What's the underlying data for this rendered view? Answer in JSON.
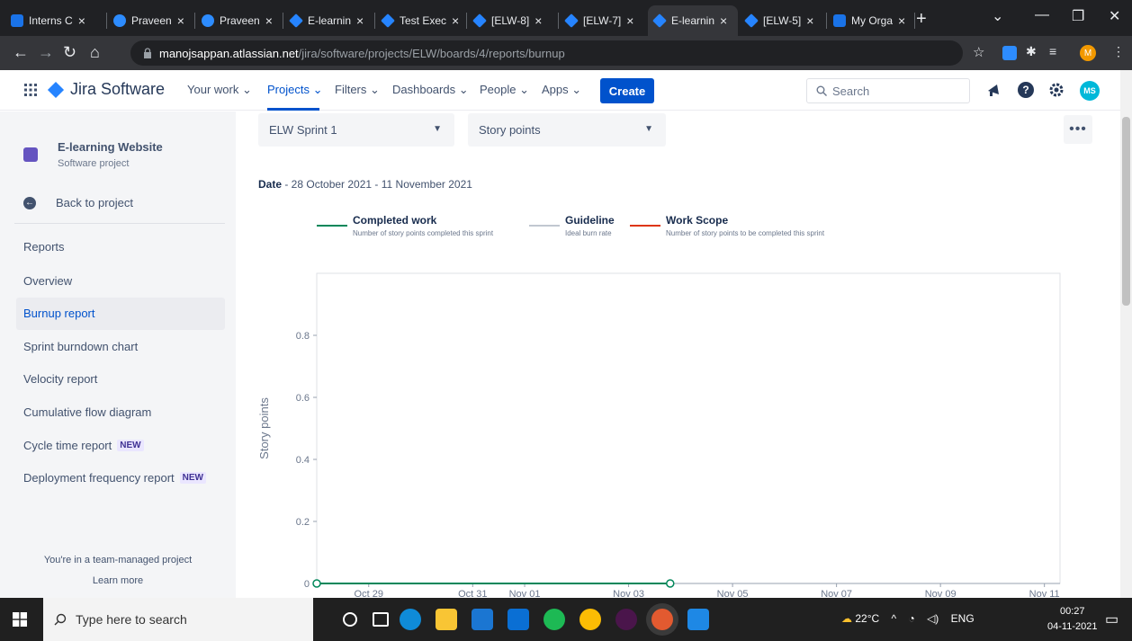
{
  "browser": {
    "tabs": [
      {
        "title": "Interns C",
        "icon": "interns-icon",
        "x": 6,
        "w": 112
      },
      {
        "title": "Praveen",
        "icon": "zoom-icon",
        "x": 120,
        "w": 96
      },
      {
        "title": "Praveen",
        "icon": "zoom-icon",
        "x": 218,
        "w": 96
      },
      {
        "title": "E-learnin",
        "icon": "jira-icon",
        "x": 316,
        "w": 100
      },
      {
        "title": "Test Exec",
        "icon": "jira-icon",
        "x": 418,
        "w": 100
      },
      {
        "title": "[ELW-8]",
        "icon": "jira-icon",
        "x": 520,
        "w": 100
      },
      {
        "title": "[ELW-7]",
        "icon": "jira-icon",
        "x": 622,
        "w": 96
      },
      {
        "title": "E-learnin",
        "icon": "jira-icon",
        "x": 720,
        "w": 100,
        "active": true
      },
      {
        "title": "[ELW-5]",
        "icon": "jira-icon",
        "x": 822,
        "w": 96
      },
      {
        "title": "My Orga",
        "icon": "org-icon",
        "x": 920,
        "w": 96
      }
    ],
    "url_host": "manojsappan.atlassian.net",
    "url_path": "/jira/software/projects/ELW/boards/4/reports/burnup",
    "profile_initial": "M"
  },
  "jira": {
    "product": "Jira Software",
    "nav": {
      "your_work": "Your work ⌄",
      "projects": "Projects ⌄",
      "filters": "Filters ⌄",
      "dashboards": "Dashboards ⌄",
      "people": "People ⌄",
      "apps": "Apps ⌄"
    },
    "create_label": "Create",
    "search_placeholder": "Search",
    "avatar_initials": "MS"
  },
  "sidebar": {
    "project_name": "E-learning Website",
    "project_type": "Software project",
    "back_label": "Back to project",
    "reports_heading": "Reports",
    "items": [
      {
        "label": "Overview"
      },
      {
        "label": "Burnup report",
        "active": true
      },
      {
        "label": "Sprint burndown chart"
      },
      {
        "label": "Velocity report"
      },
      {
        "label": "Cumulative flow diagram"
      },
      {
        "label": "Cycle time report",
        "badge": "NEW"
      },
      {
        "label": "Deployment frequency report",
        "badge": "NEW"
      }
    ],
    "team_note": "You're in a team-managed project",
    "learn_more": "Learn more"
  },
  "main": {
    "sprint_select": "ELW Sprint 1",
    "estimate_select": "Story points",
    "date_label": "Date",
    "date_range": " - 28 October 2021 - 11 November 2021",
    "legend": [
      {
        "title": "Completed work",
        "desc": "Number of story points completed this sprint",
        "color": "#00875a"
      },
      {
        "title": "Guideline",
        "desc": "Ideal burn rate",
        "color": "#c1c7d0"
      },
      {
        "title": "Work Scope",
        "desc": "Number of story points to be completed this sprint",
        "color": "#de350b"
      }
    ]
  },
  "chart_data": {
    "type": "line",
    "ylabel": "Story points",
    "xlabel": "",
    "title": "",
    "x_ticks": [
      "Oct 29",
      "Oct 31",
      "Nov 01",
      "Nov 03",
      "Nov 05",
      "Nov 07",
      "Nov 09",
      "Nov 11"
    ],
    "x_tick_days": [
      1,
      3,
      4,
      6,
      8,
      10,
      12,
      14
    ],
    "x_range_days": [
      0,
      14.3
    ],
    "y_ticks": [
      0,
      0.2,
      0.4,
      0.6,
      0.8
    ],
    "ylim": [
      0,
      1.0
    ],
    "series": [
      {
        "name": "Work Scope",
        "color": "#de350b",
        "points": [
          [
            0,
            0
          ],
          [
            6.8,
            0
          ]
        ]
      },
      {
        "name": "Completed work",
        "color": "#00875a",
        "points": [
          [
            0,
            0
          ],
          [
            6.8,
            0
          ]
        ],
        "markers": true
      }
    ]
  },
  "taskbar": {
    "search_placeholder": "Type here to search",
    "weather": "22°C",
    "lang": "ENG",
    "time": "00:27",
    "date": "04-11-2021"
  }
}
